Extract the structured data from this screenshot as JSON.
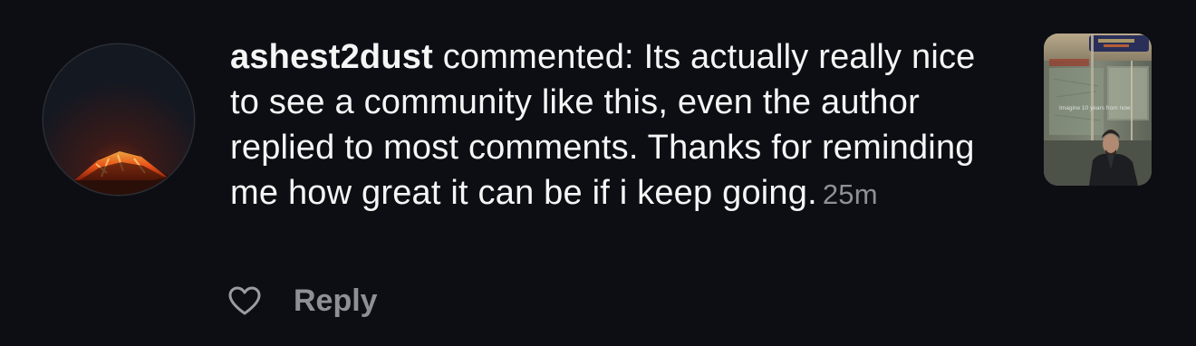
{
  "comment": {
    "username": "ashest2dust",
    "verb": " commented: ",
    "text": "Its actually really nice to see a community like this, even the author replied to most comments. Thanks for reminding me how great it can be if i keep going.",
    "timestamp": "25m"
  },
  "actions": {
    "like_icon": "heart-outline-icon",
    "reply_label": "Reply"
  },
  "avatar": {
    "icon": "volcano-profile-picture"
  },
  "post_thumbnail": {
    "caption": "Imagine 10 years from now"
  },
  "colors": {
    "background": "#0c0e13",
    "primary_text": "#f5f5f5",
    "secondary_text": "#8e9096"
  }
}
